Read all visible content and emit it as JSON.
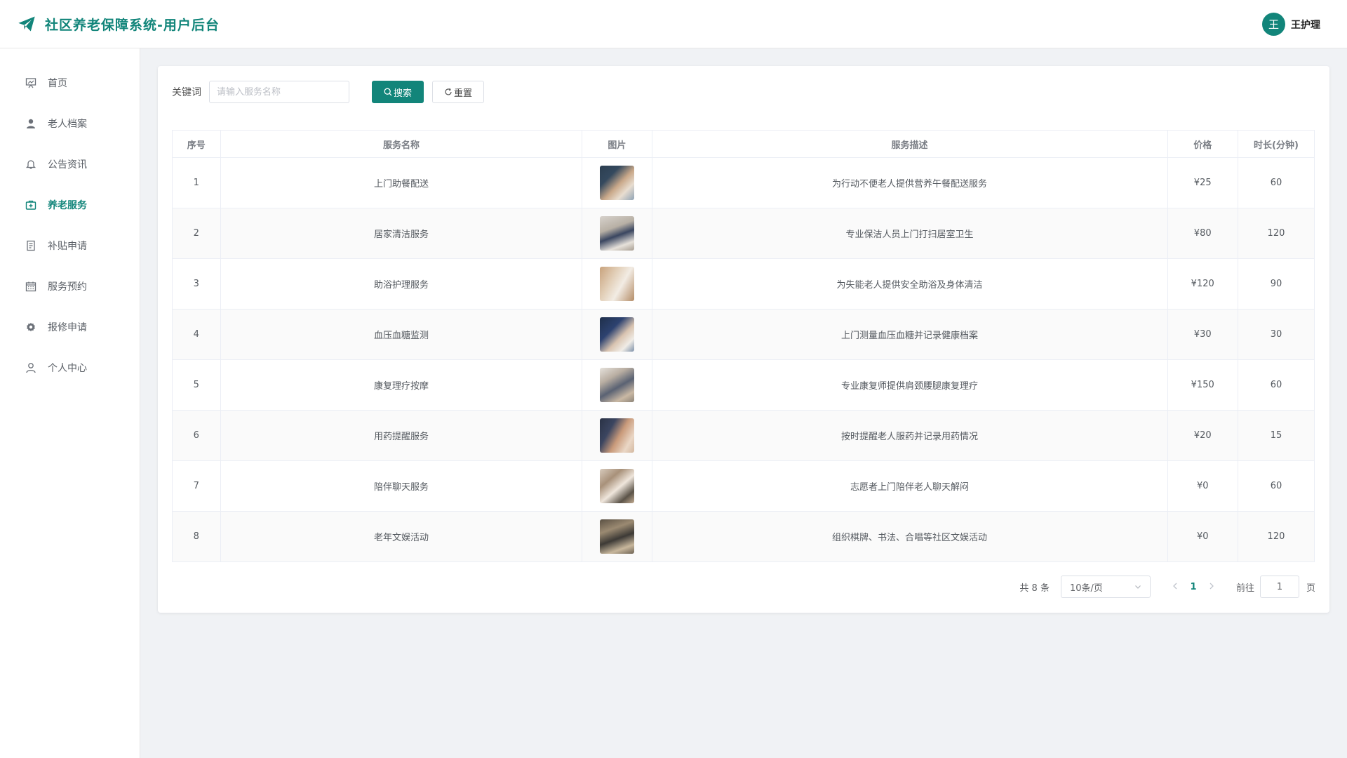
{
  "app": {
    "title": "社区养老保障系统-用户后台",
    "accent_color": "#12857a"
  },
  "user": {
    "avatar_text": "王",
    "name": "王护理"
  },
  "sidebar": {
    "items": [
      {
        "label": "首页",
        "icon": "presentation-board-icon",
        "active": false
      },
      {
        "label": "老人档案",
        "icon": "user-solid-icon",
        "active": false
      },
      {
        "label": "公告资讯",
        "icon": "bell-icon",
        "active": false
      },
      {
        "label": "养老服务",
        "icon": "first-aid-kit-icon",
        "active": true
      },
      {
        "label": "补贴申请",
        "icon": "document-icon",
        "active": false
      },
      {
        "label": "服务预约",
        "icon": "calendar-icon",
        "active": false
      },
      {
        "label": "报修申请",
        "icon": "gear-icon",
        "active": false
      },
      {
        "label": "个人中心",
        "icon": "user-outline-icon",
        "active": false
      }
    ]
  },
  "search": {
    "label": "关键词",
    "placeholder": "请输入服务名称",
    "value": "",
    "search_button": "搜索",
    "reset_button": "重置"
  },
  "table": {
    "columns": [
      "序号",
      "服务名称",
      "图片",
      "服务描述",
      "价格",
      "时长(分钟)"
    ],
    "rows": [
      {
        "index": "1",
        "name": "上门助餐配送",
        "image": "meal-delivery-photo",
        "desc": "为行动不便老人提供营养午餐配送服务",
        "price": "¥25",
        "duration": "60"
      },
      {
        "index": "2",
        "name": "居家清洁服务",
        "image": "home-cleaning-photo",
        "desc": "专业保洁人员上门打扫居室卫生",
        "price": "¥80",
        "duration": "120"
      },
      {
        "index": "3",
        "name": "助浴护理服务",
        "image": "bathing-care-photo",
        "desc": "为失能老人提供安全助浴及身体清洁",
        "price": "¥120",
        "duration": "90"
      },
      {
        "index": "4",
        "name": "血压血糖监测",
        "image": "health-monitor-photo",
        "desc": "上门测量血压血糖并记录健康档案",
        "price": "¥30",
        "duration": "30"
      },
      {
        "index": "5",
        "name": "康复理疗按摩",
        "image": "rehab-massage-photo",
        "desc": "专业康复师提供肩颈腰腿康复理疗",
        "price": "¥150",
        "duration": "60"
      },
      {
        "index": "6",
        "name": "用药提醒服务",
        "image": "medication-reminder-photo",
        "desc": "按时提醒老人服药并记录用药情况",
        "price": "¥20",
        "duration": "15"
      },
      {
        "index": "7",
        "name": "陪伴聊天服务",
        "image": "companionship-photo",
        "desc": "志愿者上门陪伴老人聊天解闷",
        "price": "¥0",
        "duration": "60"
      },
      {
        "index": "8",
        "name": "老年文娱活动",
        "image": "recreation-activity-photo",
        "desc": "组织棋牌、书法、合唱等社区文娱活动",
        "price": "¥0",
        "duration": "120"
      }
    ]
  },
  "pagination": {
    "total_text": "共 8 条",
    "page_size": "10条/页",
    "current_page": "1",
    "goto_label": "前往",
    "goto_value": "1",
    "page_suffix": "页"
  }
}
